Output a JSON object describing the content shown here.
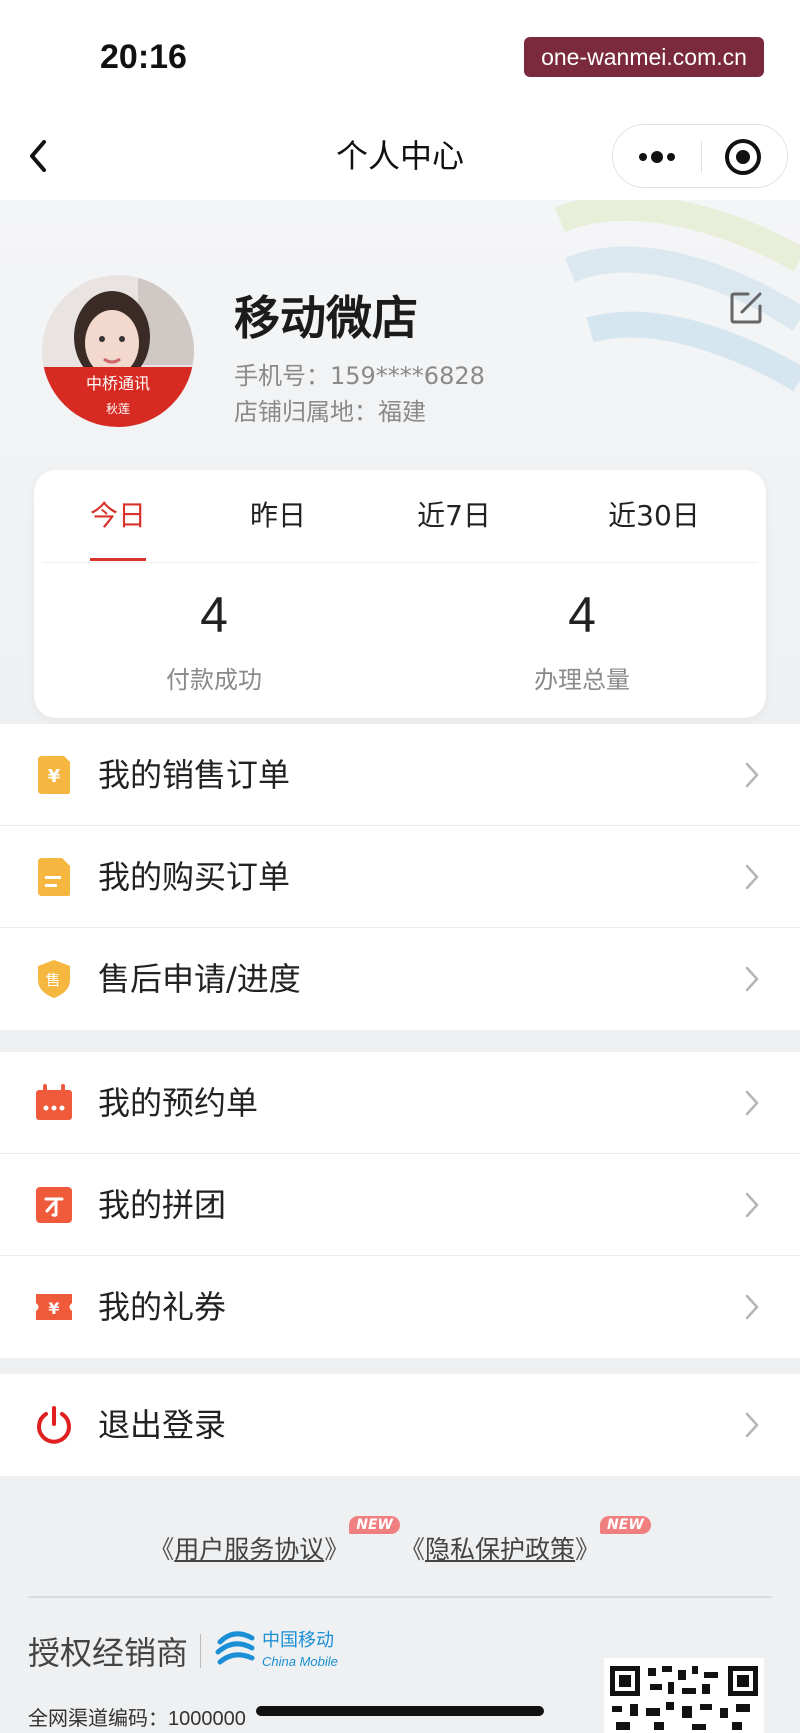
{
  "status_bar": {
    "time": "20:16",
    "watermark": "one-wanmei.com.cn"
  },
  "nav": {
    "title": "个人中心"
  },
  "profile": {
    "shop_name": "移动微店",
    "phone_label": "手机号：",
    "phone": "159****6828",
    "location_label": "店铺归属地：",
    "location": "福建",
    "avatar_badge_text": "中桥通讯",
    "avatar_name": "秋莲"
  },
  "stats": {
    "tabs": [
      {
        "label": "今日",
        "active": true
      },
      {
        "label": "昨日",
        "active": false
      },
      {
        "label": "近7日",
        "active": false
      },
      {
        "label": "近30日",
        "active": false
      }
    ],
    "metrics": [
      {
        "value": "4",
        "label": "付款成功"
      },
      {
        "value": "4",
        "label": "办理总量"
      }
    ]
  },
  "menu_groups": [
    [
      {
        "label": "我的销售订单",
        "icon": "yen-tag-icon"
      },
      {
        "label": "我的购买订单",
        "icon": "document-icon"
      },
      {
        "label": "售后申请/进度",
        "icon": "after-sales-shield-icon"
      }
    ],
    [
      {
        "label": "我的预约单",
        "icon": "calendar-icon"
      },
      {
        "label": "我的拼团",
        "icon": "group-buy-icon"
      },
      {
        "label": "我的礼券",
        "icon": "coupon-icon"
      }
    ],
    [
      {
        "label": "退出登录",
        "icon": "power-icon"
      }
    ]
  ],
  "footer": {
    "agreement_open": "《",
    "agreement": "用户服务协议",
    "agreement_close": "》",
    "privacy_open": "《",
    "privacy": "隐私保护政策",
    "privacy_close": "》",
    "new_badge": "NEW",
    "dealer_label": "授权经销商",
    "brand_cn": "中国移动",
    "brand_en": "China Mobile",
    "channel_label": "全网渠道编码：",
    "channel_code": "1000000"
  },
  "colors": {
    "accent": "#d9342b",
    "icon_yellow": "#f5b740",
    "icon_red": "#ee5a3a",
    "power_red": "#e02020"
  }
}
